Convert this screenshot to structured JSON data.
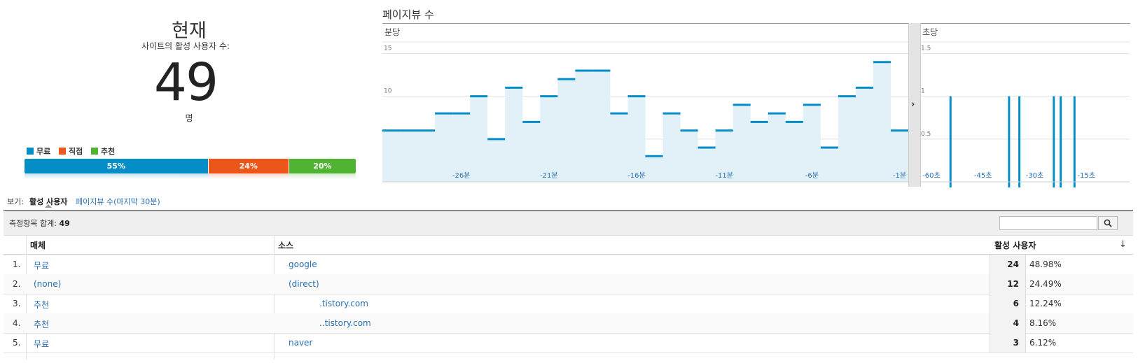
{
  "summary": {
    "now_title": "현재",
    "active_label": "사이트의 활성 사용자 수:",
    "active_count": "49",
    "unit": "명",
    "legend": [
      {
        "label": "무료",
        "color": "#058dc7"
      },
      {
        "label": "직접",
        "color": "#ed561b"
      },
      {
        "label": "추천",
        "color": "#50b432"
      }
    ],
    "share": [
      {
        "label": "55%",
        "value": 55,
        "color": "#058dc7"
      },
      {
        "label": "24%",
        "value": 24,
        "color": "#ed561b"
      },
      {
        "label": "20%",
        "value": 20,
        "color": "#50b432"
      }
    ]
  },
  "chart": {
    "title": "페이지뷰 수",
    "per_minute_label": "분당",
    "per_second_label": "초당",
    "expand_icon": "chevron-right-icon"
  },
  "chart_data": [
    {
      "type": "area",
      "subtitle": "분당",
      "ylim": [
        0,
        17
      ],
      "yticks": [
        5,
        10,
        15
      ],
      "xtick_labels": [
        "-26분",
        "-21분",
        "-16분",
        "-11분",
        "-6분",
        "-1분"
      ],
      "xtick_minutes": [
        -26,
        -21,
        -16,
        -11,
        -6,
        -1
      ],
      "x": [
        -30,
        -29,
        -28,
        -27,
        -26,
        -25,
        -24,
        -23,
        -22,
        -21,
        -20,
        -19,
        -18,
        -17,
        -16,
        -15,
        -14,
        -13,
        -12,
        -11,
        -10,
        -9,
        -8,
        -7,
        -6,
        -5,
        -4,
        -3,
        -2,
        -1
      ],
      "values": [
        6,
        6,
        6,
        8,
        8,
        10,
        5,
        11,
        7,
        10,
        12,
        13,
        13,
        8,
        10,
        3,
        8,
        6,
        4,
        6,
        9,
        7,
        8,
        7,
        9,
        4,
        10,
        11,
        14,
        6
      ],
      "color": "#058dc7",
      "grid": true
    },
    {
      "type": "bar",
      "subtitle": "초당",
      "ylim": [
        0,
        1.7
      ],
      "yticks": [
        0.5,
        1,
        1.5
      ],
      "ytick_labels": [
        "0.5",
        "1",
        "1.5"
      ],
      "xtick_labels": [
        "-60초",
        "-45초",
        "-30초",
        "-15초"
      ],
      "xtick_seconds": [
        -60,
        -45,
        -30,
        -15
      ],
      "bars_x": [
        -52,
        -35,
        -32,
        -22,
        -20,
        -16
      ],
      "bars_value": [
        1,
        1,
        1,
        1,
        1,
        1
      ],
      "color": "#058dc7",
      "grid": true
    }
  ],
  "view": {
    "label": "보기:",
    "tab_active_users": "활성 사용자",
    "tab_pageviews": "페이지뷰 수(마지막 30분)"
  },
  "table": {
    "total_label": "측정항목 합계:",
    "total_value": "49",
    "search_placeholder": "",
    "search_icon": "search-icon",
    "headers": {
      "medium": "매체",
      "source": "소스",
      "active_users": "활성 사용자"
    },
    "rows": [
      {
        "idx": "1.",
        "medium": "무료",
        "source": "google",
        "count": "24",
        "pct": "48.98%"
      },
      {
        "idx": "2.",
        "medium": "(none)",
        "source": "(direct)",
        "count": "12",
        "pct": "24.49%"
      },
      {
        "idx": "3.",
        "medium": "추천",
        "source": ".tistory.com",
        "count": "6",
        "pct": "12.24%"
      },
      {
        "idx": "4.",
        "medium": "추천",
        "source": "..tistory.com",
        "count": "4",
        "pct": "8.16%"
      },
      {
        "idx": "5.",
        "medium": "무료",
        "source": "naver",
        "count": "3",
        "pct": "6.12%"
      }
    ]
  }
}
